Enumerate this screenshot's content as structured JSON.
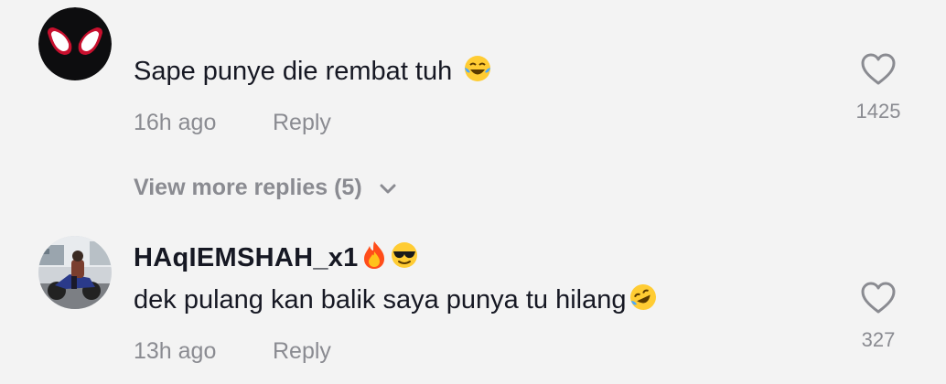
{
  "comments": [
    {
      "username": "",
      "text": "Sape punye die rembat tuh",
      "time": "16h ago",
      "reply_label": "Reply",
      "likes": "1425"
    },
    {
      "username": "HAqIEMSHAH_x1",
      "text": "dek pulang kan balik saya punya tu hilang",
      "time": "13h ago",
      "reply_label": "Reply",
      "likes": "327"
    }
  ],
  "view_more_replies": "View more replies (5)",
  "colors": {
    "background": "#f3f3f3",
    "text_primary": "#161823",
    "text_secondary": "#8a8b91",
    "spiderman_red": "#c8102e"
  },
  "icons": [
    "spiderman-mask-avatar",
    "laughing-tears-emoji",
    "chevron-down-icon",
    "heart-outline-icon",
    "fire-emoji",
    "sunglasses-emoji",
    "rofl-emoji",
    "motorcycle-photo-avatar"
  ]
}
